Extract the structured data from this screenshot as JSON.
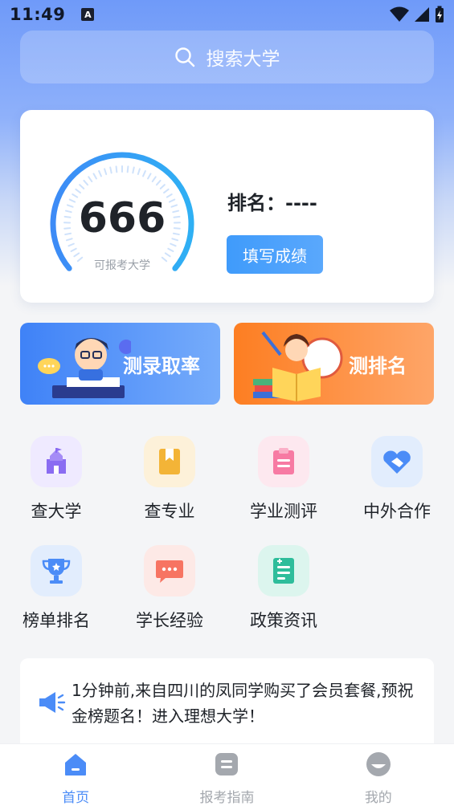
{
  "status": {
    "time": "11:49",
    "notif": "A"
  },
  "search": {
    "placeholder": "搜索大学"
  },
  "score": {
    "value": "666",
    "sublabel": "可报考大学",
    "rank": "排名：----",
    "fill_button": "填写成绩"
  },
  "banners": [
    {
      "label": "测录取率",
      "color": "#3f82f7"
    },
    {
      "label": "测排名",
      "color": "#fd7e22"
    }
  ],
  "grid": [
    {
      "label": "查大学",
      "icon": "school-icon",
      "color": "#8a6cf2",
      "bg": "#efeaff"
    },
    {
      "label": "查专业",
      "icon": "book-icon",
      "color": "#f3b437",
      "bg": "#fdf1d9"
    },
    {
      "label": "学业测评",
      "icon": "clipboard-icon",
      "color": "#f77aa3",
      "bg": "#fde8ef"
    },
    {
      "label": "中外合作",
      "icon": "handshake-icon",
      "color": "#4b8cf7",
      "bg": "#e2edfd"
    },
    {
      "label": "榜单排名",
      "icon": "trophy-icon",
      "color": "#4b8cf7",
      "bg": "#e2edfd"
    },
    {
      "label": "学长经验",
      "icon": "chat-icon",
      "color": "#f77462",
      "bg": "#fde9e6"
    },
    {
      "label": "政策资讯",
      "icon": "document-icon",
      "color": "#2ebd9b",
      "bg": "#dcf5ee"
    }
  ],
  "notice": {
    "text": "1分钟前,来自四川的凤同学购买了会员套餐,预祝金榜题名！进入理想大学！"
  },
  "tabs": [
    {
      "label": "首页",
      "icon": "home-icon",
      "active": true
    },
    {
      "label": "报考指南",
      "icon": "guide-icon",
      "active": false
    },
    {
      "label": "我的",
      "icon": "profile-icon",
      "active": false
    }
  ],
  "colors": {
    "accent": "#4b8cf7",
    "header": "#6f9af9"
  }
}
